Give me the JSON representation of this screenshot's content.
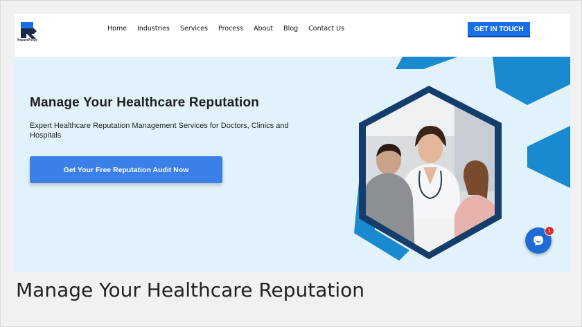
{
  "brand": {
    "logo_text": "ReputeForge"
  },
  "nav": {
    "items": [
      "Home",
      "Industries",
      "Services",
      "Process",
      "About",
      "Blog",
      "Contact Us"
    ]
  },
  "header": {
    "cta_label": "GET IN TOUCH"
  },
  "hero": {
    "title": "Manage Your Healthcare Reputation",
    "subtitle": "Expert Healthcare Reputation Management Services for Doctors, Clinics and Hospitals",
    "button_label": "Get Your Free Reputation Audit Now"
  },
  "chat": {
    "badge_count": "1",
    "icon": "chat-bubble-icon"
  },
  "page": {
    "heading": "Manage Your Healthcare Reputation"
  },
  "colors": {
    "accent": "#1a6fe8",
    "hero_bg": "#e2f2fa",
    "hex_blue": "#1a8ad0",
    "hex_navy": "#143d6b"
  }
}
